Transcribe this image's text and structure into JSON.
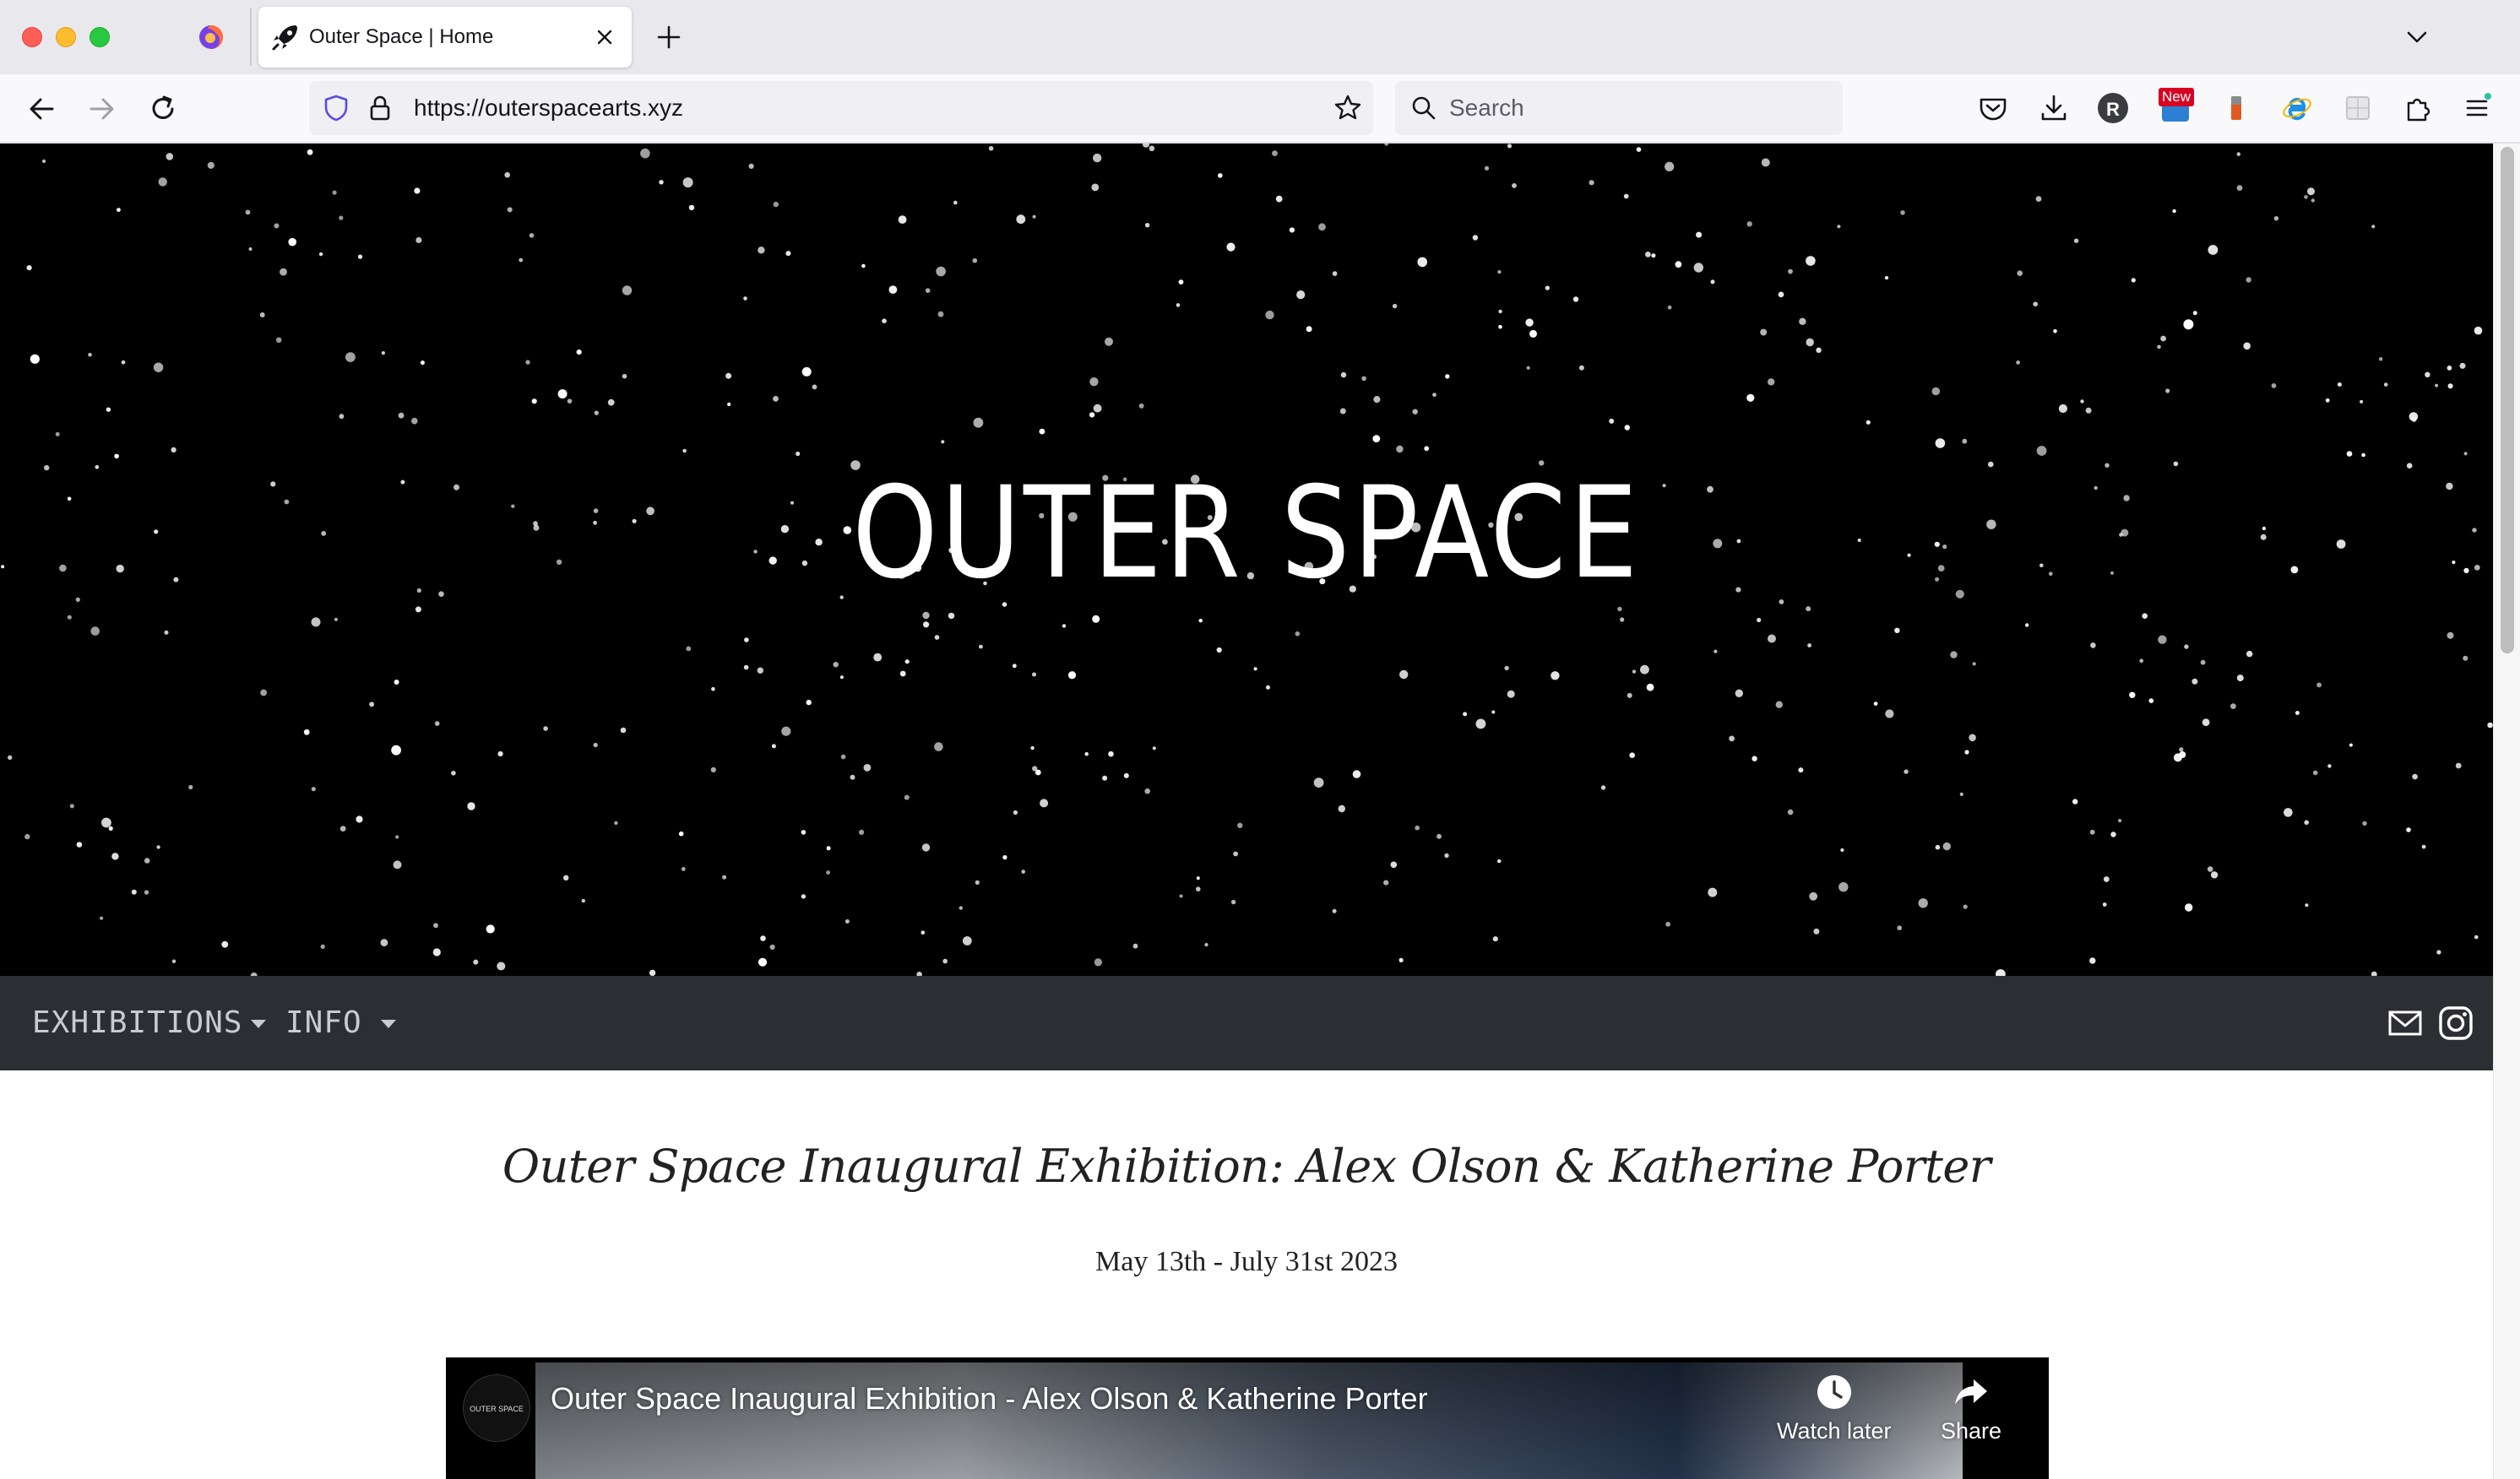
{
  "browser": {
    "tab": {
      "title": "Outer Space | Home"
    },
    "url": "https://outerspacearts.xyz",
    "search_placeholder": "Search",
    "toolbar_icons": [
      "pocket-icon",
      "download-icon",
      "profile-r-icon",
      "new-badge-extension-icon",
      "battery-extension-icon",
      "ie-extension-icon",
      "grid-extension-icon",
      "extensions-puzzle-icon",
      "menu-icon"
    ],
    "new_badge": "New",
    "profile_letter": "R"
  },
  "hero": {
    "title": "OUTER SPACE"
  },
  "site_nav": {
    "items": [
      {
        "label": "EXHIBITIONS"
      },
      {
        "label": "INFO"
      }
    ]
  },
  "exhibition": {
    "title": "Outer Space Inaugural Exhibition: Alex Olson & Katherine Porter",
    "dates": "May 13th - July 31st 2023"
  },
  "video": {
    "channel_logo_text": "OUTER SPACE",
    "title": "Outer Space Inaugural Exhibition - Alex Olson & Katherine Porter",
    "watch_later": "Watch later",
    "share": "Share"
  },
  "colors": {
    "hero_bg": "#000000",
    "nav_bg": "#2c2e33",
    "nav_text": "#c9cbd0",
    "browser_tabbar": "#e9e9ed"
  }
}
